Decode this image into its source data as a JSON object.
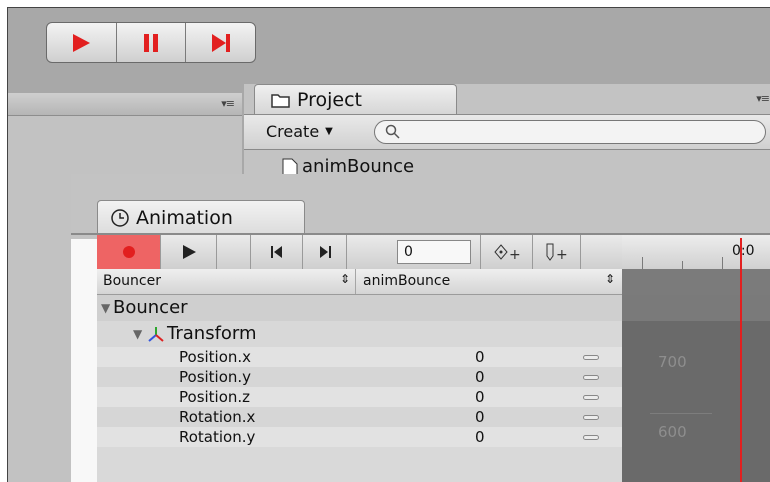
{
  "colors": {
    "accent_red": "#e21f1f",
    "record_bg": "#ee6464",
    "panel": "#c3c3c3"
  },
  "playback": {
    "play_icon": "play-icon",
    "pause_icon": "pause-icon",
    "step_icon": "step-forward-icon"
  },
  "project": {
    "tab_label": "Project",
    "create_label": "Create",
    "search_placeholder": "",
    "asset_item": "animBounce"
  },
  "animation": {
    "tab_label": "Animation",
    "frame_value": "0",
    "time_label": "0:0",
    "object_selector": "Bouncer",
    "clip_selector": "animBounce",
    "tree": {
      "root": "Bouncer",
      "component": "Transform",
      "properties": [
        {
          "name": "Position.x",
          "value": "0"
        },
        {
          "name": "Position.y",
          "value": "0"
        },
        {
          "name": "Position.z",
          "value": "0"
        },
        {
          "name": "Rotation.x",
          "value": "0"
        },
        {
          "name": "Rotation.y",
          "value": "0"
        }
      ]
    },
    "curve_labels": [
      "700",
      "600"
    ]
  }
}
